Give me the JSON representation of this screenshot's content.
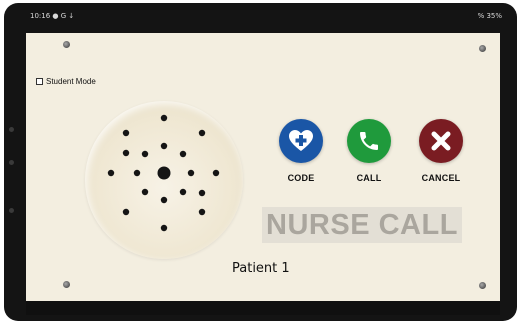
{
  "status_bar": {
    "time": "10:16",
    "left_icons": "● G ↓",
    "right": "% 35%"
  },
  "student_mode": {
    "label": "Student Mode",
    "checked": false
  },
  "actions": [
    {
      "id": "code",
      "label": "CODE",
      "color": "#1a56a6",
      "icon": "heart-plus-icon"
    },
    {
      "id": "call",
      "label": "CALL",
      "color": "#1f9a3c",
      "icon": "phone-icon"
    },
    {
      "id": "cancel",
      "label": "CANCEL",
      "color": "#7a1c22",
      "icon": "x-icon"
    }
  ],
  "banner": {
    "text": "NURSE CALL"
  },
  "patient": {
    "label": "Patient 1"
  }
}
